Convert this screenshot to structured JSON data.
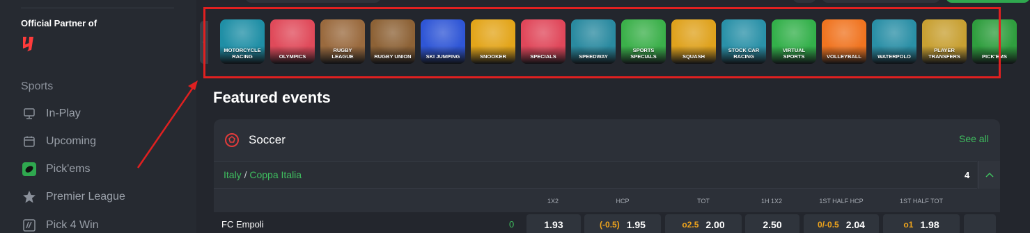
{
  "sidebar": {
    "partner_text": "Official Partner of",
    "section": "Sports",
    "items": [
      {
        "label": "In-Play",
        "icon": "monitor-icon"
      },
      {
        "label": "Upcoming",
        "icon": "calendar-icon"
      },
      {
        "label": "Pick'ems",
        "icon": "pickems-icon"
      },
      {
        "label": "Premier League",
        "icon": "star-icon"
      },
      {
        "label": "Pick 4 Win",
        "icon": "pick4win-icon"
      }
    ]
  },
  "strip": {
    "tiles": [
      {
        "label": "MOTORCYCLE RACING",
        "color": "#1f8fa6"
      },
      {
        "label": "OLYMPICS",
        "color": "#e04a5a"
      },
      {
        "label": "RUGBY LEAGUE",
        "color": "#9a6a3e"
      },
      {
        "label": "RUGBY UNION",
        "color": "#8d6236"
      },
      {
        "label": "SKI JUMPING",
        "color": "#2f56d6"
      },
      {
        "label": "SNOOKER",
        "color": "#e3a51a"
      },
      {
        "label": "SPECIALS",
        "color": "#e0475a"
      },
      {
        "label": "SPEEDWAY",
        "color": "#2a8aa0"
      },
      {
        "label": "SPORTS SPECIALS",
        "color": "#3bb04a"
      },
      {
        "label": "SQUASH",
        "color": "#dfa21d"
      },
      {
        "label": "STOCK CAR RACING",
        "color": "#2a91a8"
      },
      {
        "label": "VIRTUAL SPORTS",
        "color": "#33b04a"
      },
      {
        "label": "VOLLEYBALL",
        "color": "#f07420"
      },
      {
        "label": "WATERPOLO",
        "color": "#2a8fa6"
      },
      {
        "label": "PLAYER TRANSFERS",
        "color": "#c8a032"
      },
      {
        "label": "PICK'EMS",
        "color": "#2f9e3e"
      }
    ]
  },
  "featured": {
    "title": "Featured events",
    "sport": "Soccer",
    "see_all": "See all",
    "league_country": "Italy",
    "league_sep": "/",
    "league_name": "Coppa Italia",
    "league_count": "4",
    "markets": [
      "1X2",
      "HCP",
      "TOT",
      "1H 1X2",
      "1ST HALF HCP",
      "1ST HALF TOT"
    ],
    "event": {
      "team": "FC Empoli",
      "score": "0",
      "odds": [
        {
          "hcp": "",
          "value": "1.93"
        },
        {
          "hcp": "(-0.5)",
          "value": "1.95"
        },
        {
          "hcp": "o2.5",
          "value": "2.00"
        },
        {
          "hcp": "",
          "value": "2.50"
        },
        {
          "hcp": "0/-0.5",
          "value": "2.04"
        },
        {
          "hcp": "o1",
          "value": "1.98"
        }
      ]
    }
  },
  "colors": {
    "accent_green": "#3fbf5f",
    "annotation_red": "#e02020",
    "odds_hcp": "#f0a51c"
  }
}
